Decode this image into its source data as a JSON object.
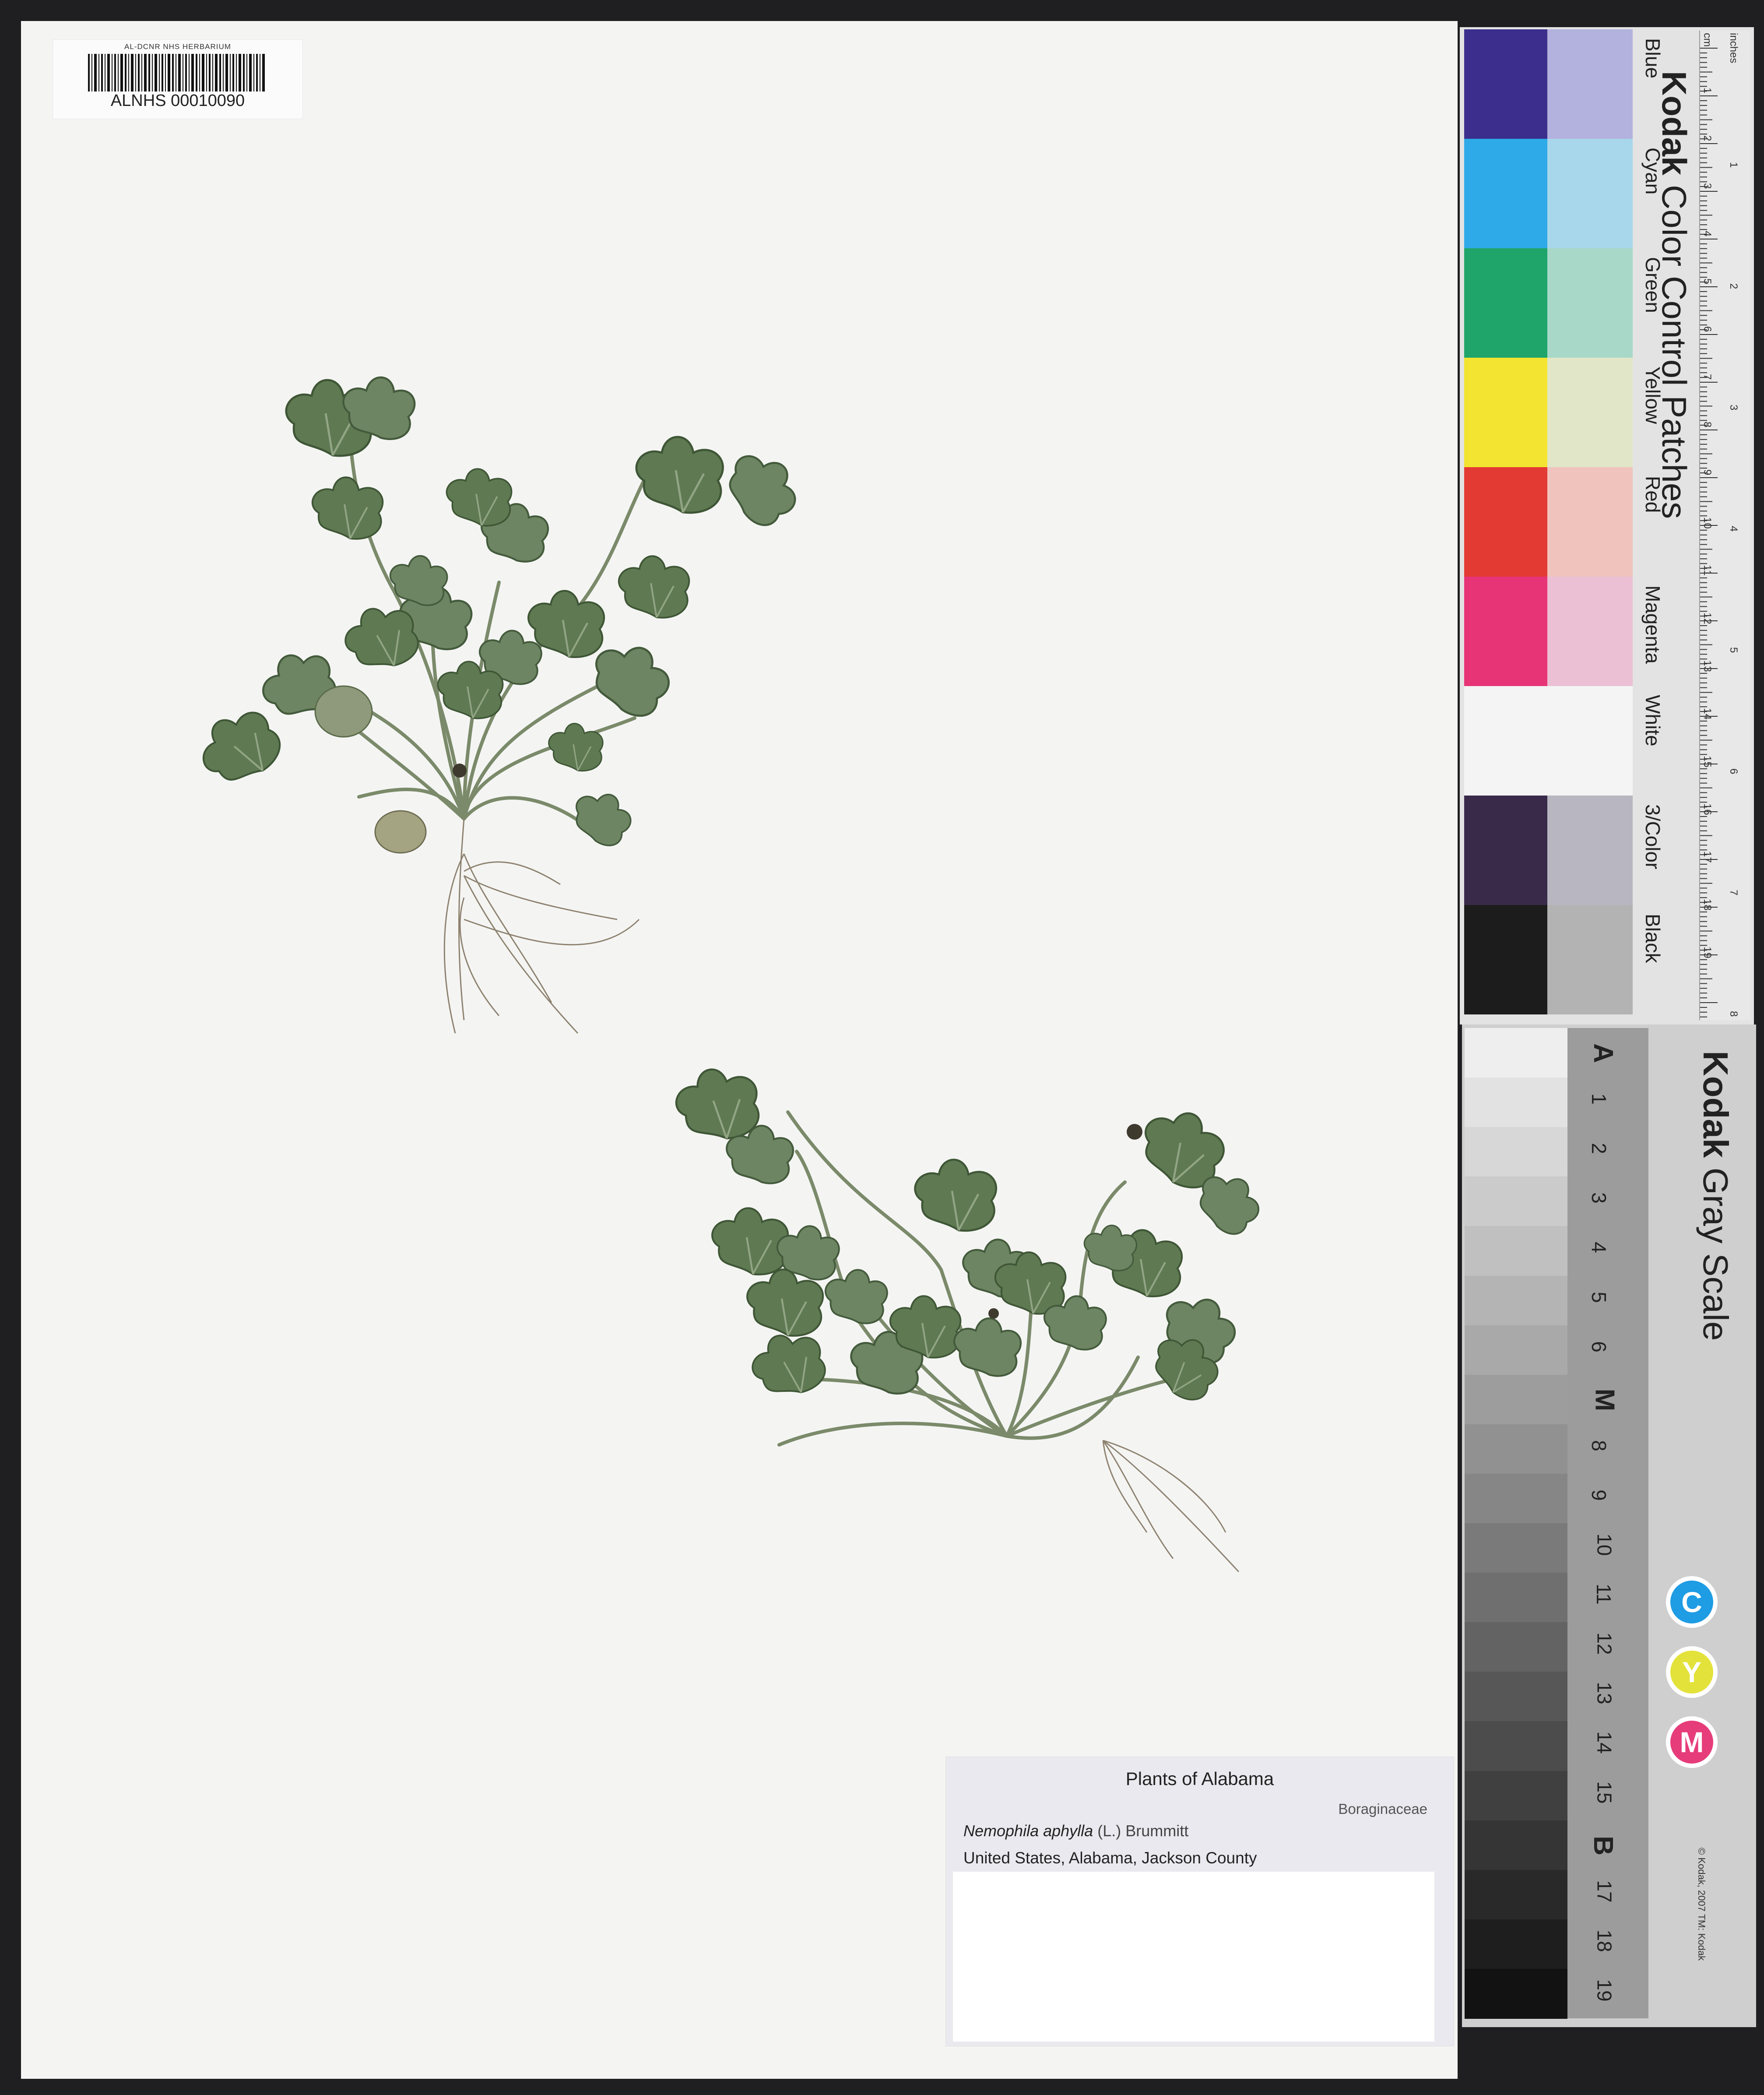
{
  "barcode": {
    "institution": "AL-DCNR NHS HERBARIUM",
    "catalog_number": "ALNHS 00010090"
  },
  "specimen_label": {
    "title": "Plants of Alabama",
    "family": "Boraginaceae",
    "taxon_name": "Nemophila aphylla",
    "taxon_author": "(L.) Brummitt",
    "locality": "United States, Alabama, Jackson County"
  },
  "color_card": {
    "brand": "Kodak",
    "title": "Color Control Patches",
    "copyright": "© Kodak, 2007  TM: Kodak",
    "patches": [
      {
        "name": "Blue",
        "dark": "#3b2e8c",
        "light": "#b3b1de"
      },
      {
        "name": "Cyan",
        "dark": "#2eaae8",
        "light": "#a8d6ea"
      },
      {
        "name": "Green",
        "dark": "#1fa56a",
        "light": "#a7d8c8"
      },
      {
        "name": "Yellow",
        "dark": "#f2e430",
        "light": "#e2e6c8"
      },
      {
        "name": "Red",
        "dark": "#e33a34",
        "light": "#f0c4bd"
      },
      {
        "name": "Magenta",
        "dark": "#e73476",
        "light": "#ebbfd4"
      },
      {
        "name": "White",
        "dark": "#f4f4f4",
        "light": "#f4f4f4"
      },
      {
        "name": "3/Color",
        "dark": "#3a2a4a",
        "light": "#b8b6c0"
      },
      {
        "name": "Black",
        "dark": "#1c1c1c",
        "light": "#b3b3b3"
      }
    ],
    "ruler_unit_top": "inches",
    "ruler_unit_cm": "cm",
    "ruler_numbers": [
      "1",
      "2",
      "3",
      "4",
      "5",
      "6",
      "7",
      "8",
      "9",
      "10",
      "11",
      "12",
      "13",
      "14",
      "15",
      "16",
      "17",
      "18",
      "19"
    ],
    "ruler_inches": [
      "1",
      "2",
      "3",
      "4",
      "5",
      "6",
      "7",
      "8"
    ]
  },
  "gray_card": {
    "brand": "Kodak",
    "title": "Gray Scale",
    "copyright": "© Kodak, 2007  TM: Kodak",
    "labels": [
      "A",
      "1",
      "2",
      "3",
      "4",
      "5",
      "6",
      "M",
      "8",
      "9",
      "10",
      "11",
      "12",
      "13",
      "14",
      "15",
      "B",
      "17",
      "18",
      "19"
    ],
    "cym": [
      {
        "letter": "C",
        "color": "#1e9ce4"
      },
      {
        "letter": "Y",
        "color": "#e3e23a"
      },
      {
        "letter": "M",
        "color": "#e63c7a"
      }
    ]
  }
}
